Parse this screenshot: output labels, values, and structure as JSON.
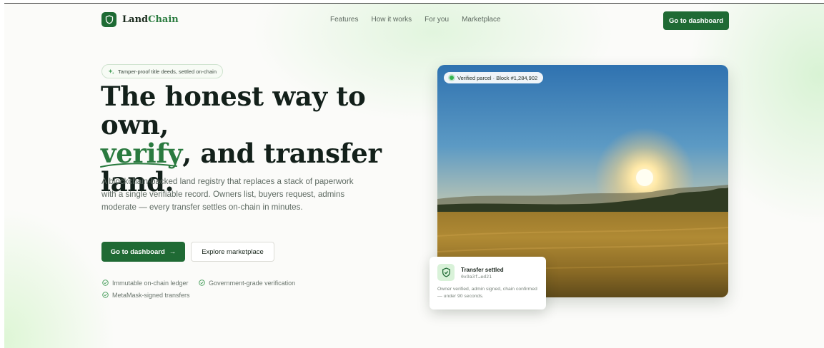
{
  "brand": {
    "name_part1": "Land",
    "name_part2": "Chain",
    "logo_icon": "shield-icon"
  },
  "nav": {
    "items": [
      "Features",
      "How it works",
      "For you",
      "Marketplace"
    ],
    "cta": "Go to dashboard"
  },
  "hero": {
    "pill": "Tamper-proof title deeds, settled on-chain",
    "pill_icon": "sparkle-icon",
    "headline_line1": "The honest way to own,",
    "headline_highlight": "verify",
    "headline_line2_rest": ", and transfer",
    "headline_line3": "land.",
    "lead": "A blockchain-backed land registry that replaces a stack of paperwork with a single verifiable record. Owners list, buyers request, admins moderate — every transfer settles on-chain in minutes.",
    "primary_cta": "Go to dashboard",
    "primary_cta_arrow": "→",
    "secondary_cta": "Explore marketplace",
    "features": [
      "Immutable on-chain ledger",
      "Government-grade verification",
      "MetaMask-signed transfers"
    ],
    "feature_icon": "check-circle-icon"
  },
  "visual": {
    "badge": "Verified parcel · Block #1,284,902",
    "card": {
      "title": "Transfer settled",
      "hash": "0x9a3f…ed21",
      "description": "Owner verified, admin signed, chain confirmed — under 90 seconds.",
      "icon": "shield-check-icon"
    }
  },
  "colors": {
    "brand_green": "#1f6a34",
    "accent_green": "#2a7a3f",
    "status_green": "#34b34f"
  }
}
